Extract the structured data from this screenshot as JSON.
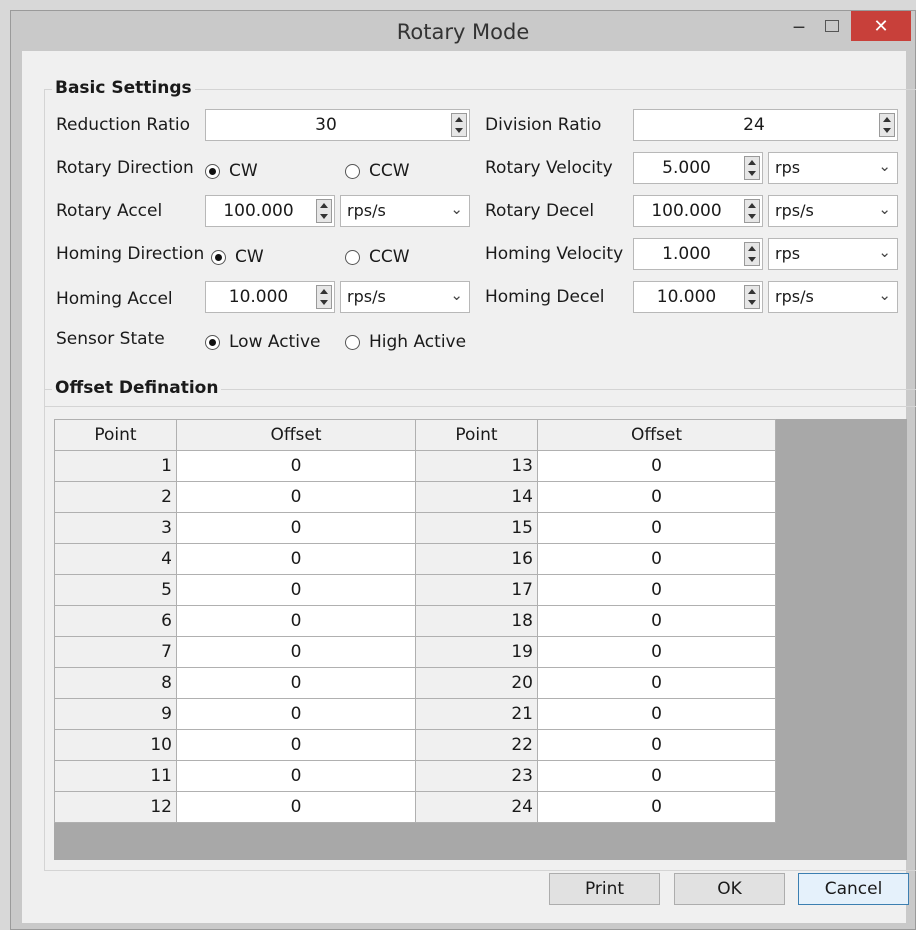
{
  "window": {
    "title": "Rotary Mode",
    "minimize_glyph": "‒",
    "close_glyph": "✕"
  },
  "basic_settings": {
    "title": "Basic Settings",
    "reduction_ratio": {
      "label": "Reduction Ratio",
      "value": "30"
    },
    "division_ratio": {
      "label": "Division Ratio",
      "value": "24"
    },
    "rotary_direction": {
      "label": "Rotary Direction",
      "options": [
        "CW",
        "CCW"
      ],
      "selected": "CW"
    },
    "rotary_velocity": {
      "label": "Rotary Velocity",
      "value": "5.000",
      "unit": "rps"
    },
    "rotary_accel": {
      "label": "Rotary Accel",
      "value": "100.000",
      "unit": "rps/s"
    },
    "rotary_decel": {
      "label": "Rotary Decel",
      "value": "100.000",
      "unit": "rps/s"
    },
    "homing_direction": {
      "label": "Homing Direction",
      "options": [
        "CW",
        "CCW"
      ],
      "selected": "CW"
    },
    "homing_velocity": {
      "label": "Homing Velocity",
      "value": "1.000",
      "unit": "rps"
    },
    "homing_accel": {
      "label": "Homing Accel",
      "value": "10.000",
      "unit": "rps/s"
    },
    "homing_decel": {
      "label": "Homing Decel",
      "value": "10.000",
      "unit": "rps/s"
    },
    "sensor_state": {
      "label": "Sensor State",
      "options": [
        "Low Active",
        "High Active"
      ],
      "selected": "Low Active"
    }
  },
  "offset_definition": {
    "title": "Offset Defination",
    "columns": [
      "Point",
      "Offset",
      "Point",
      "Offset"
    ],
    "rows": [
      [
        "1",
        "0",
        "13",
        "0"
      ],
      [
        "2",
        "0",
        "14",
        "0"
      ],
      [
        "3",
        "0",
        "15",
        "0"
      ],
      [
        "4",
        "0",
        "16",
        "0"
      ],
      [
        "5",
        "0",
        "17",
        "0"
      ],
      [
        "6",
        "0",
        "18",
        "0"
      ],
      [
        "7",
        "0",
        "19",
        "0"
      ],
      [
        "8",
        "0",
        "20",
        "0"
      ],
      [
        "9",
        "0",
        "21",
        "0"
      ],
      [
        "10",
        "0",
        "22",
        "0"
      ],
      [
        "11",
        "0",
        "23",
        "0"
      ],
      [
        "12",
        "0",
        "24",
        "0"
      ]
    ]
  },
  "buttons": {
    "print": "Print",
    "ok": "OK",
    "cancel": "Cancel"
  },
  "colors": {
    "close_button": "#c8403a",
    "window_frame": "#c9c9c9",
    "client_bg": "#f0f0f0"
  }
}
